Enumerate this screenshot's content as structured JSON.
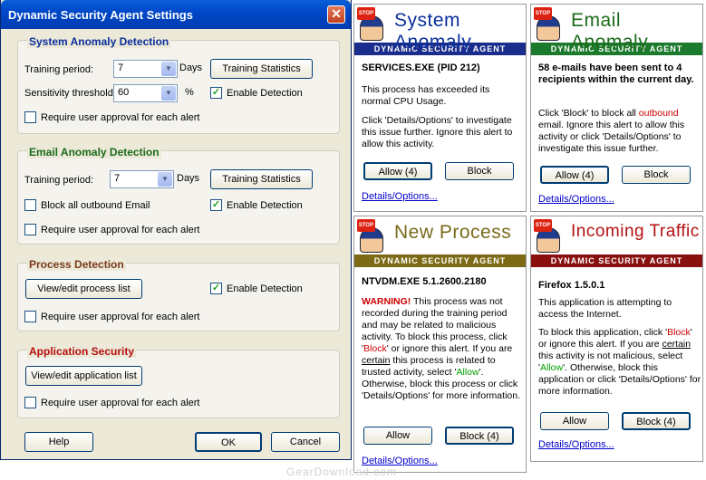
{
  "settings": {
    "title": "Dynamic Security Agent Settings",
    "close": "✕",
    "system": {
      "title": "System Anomaly Detection",
      "training_label": "Training period:",
      "training_value": "7",
      "days": "Days",
      "stats_button": "Training Statistics",
      "sensitivity_label": "Sensitivity threshold:",
      "sensitivity_value": "60",
      "percent": "%",
      "enable": "Enable Detection",
      "require": "Require user approval for each alert"
    },
    "email": {
      "title": "Email Anomaly Detection",
      "training_label": "Training period:",
      "training_value": "7",
      "days": "Days",
      "stats_button": "Training Statistics",
      "block_all": "Block all outbound Email",
      "enable": "Enable Detection",
      "require": "Require user approval for each alert"
    },
    "process": {
      "title": "Process Detection",
      "edit_button": "View/edit process list",
      "enable": "Enable Detection",
      "require": "Require user approval for each alert"
    },
    "application": {
      "title": "Application Security",
      "edit_button": "View/edit application list",
      "require": "Require user approval for each alert"
    },
    "help": "Help",
    "ok": "OK",
    "cancel": "Cancel"
  },
  "brand_band": "DYNAMIC SECURITY AGENT",
  "stop_text": "STOP",
  "panels": {
    "system_anomaly": {
      "title": "System Anomaly",
      "heading": "SERVICES.EXE (PID 212)",
      "body1": "This process has exceeded its normal CPU Usage.",
      "body2": "Click 'Details/Options' to investigate this issue further.  Ignore this alert to allow this activity.",
      "allow": "Allow (4)",
      "block": "Block",
      "link": "Details/Options..."
    },
    "email_anomaly": {
      "title": "Email Anomaly",
      "heading": "58 e-mails have been sent to 4 recipients within the current day.",
      "body_pre": "Click 'Block' to block all ",
      "body_red": "outbound",
      "body_post": " email. Ignore this alert to allow this activity or click 'Details/Options' to investigate this issue further.",
      "allow": "Allow (4)",
      "block": "Block",
      "link": "Details/Options..."
    },
    "new_process": {
      "title": "New Process",
      "heading": "NTVDM.EXE 5.1.2600.2180",
      "warning": "WARNING!",
      "t1": " This process was not recorded during the training period and may be related to malicious activity. To block this process, click '",
      "block_word": "Block",
      "t2": "' or ignore this alert. If you are ",
      "certain": "certain",
      "t3": " this process is related to trusted activity, select '",
      "allow_word": "Allow",
      "t4": "'. Otherwise, block this process or click 'Details/Options' for more information.",
      "allow": "Allow",
      "block": "Block (4)",
      "link": "Details/Options..."
    },
    "incoming_traffic": {
      "title": "Incoming Traffic",
      "heading": "Firefox 1.5.0.1",
      "p1": "This application is attempting to access the Internet.",
      "t1": "To block this application, click '",
      "block_word": "Block",
      "t2": "' or ignore this alert. If you are ",
      "certain": "certain",
      "t3": " this activity is not malicious, select '",
      "allow_word": "Allow",
      "t4": "'. Otherwise, block this application or click 'Details/Options' for more information.",
      "allow": "Allow",
      "block": "Block (4)",
      "link": "Details/Options..."
    }
  },
  "watermark": "GearDownload.com",
  "colors": {
    "blue_title": "#0a2f9c",
    "green_title": "#1b6b1b",
    "olive_title": "#7a6a1b",
    "red_title": "#b41010",
    "blue_band": "#1a2d8c",
    "green_band": "#1c7a2c",
    "olive_band": "#7c6a14",
    "red_band": "#8a1010"
  }
}
